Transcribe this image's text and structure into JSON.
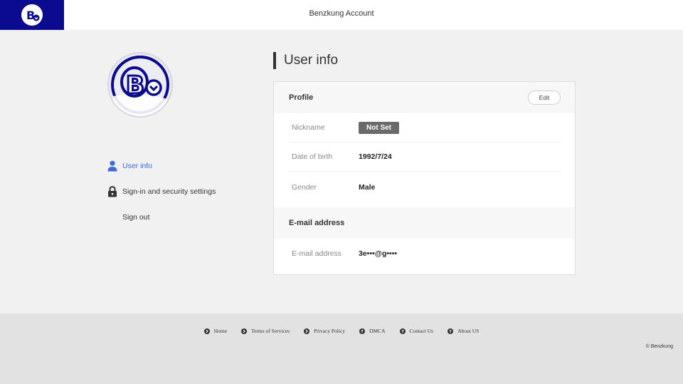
{
  "header": {
    "title": "Benzkung Account",
    "logo_icon": "benzkung-logo",
    "brand_color": "#0b0b8f"
  },
  "sidebar": {
    "items": [
      {
        "label": "User info",
        "icon": "user-icon",
        "active": true
      },
      {
        "label": "Sign-in and security settings",
        "icon": "lock-icon",
        "active": false
      },
      {
        "label": "Sign out",
        "icon": "",
        "active": false
      }
    ],
    "active_color": "#3f6bd9"
  },
  "main": {
    "title": "User info",
    "profile": {
      "heading": "Profile",
      "edit_label": "Edit",
      "rows": [
        {
          "label": "Nickname",
          "value": "Not Set"
        },
        {
          "label": "Date of birth",
          "value": "1992/7/24"
        },
        {
          "label": "Gender",
          "value": "Male"
        }
      ]
    },
    "email": {
      "heading": "E-mail address",
      "rows": [
        {
          "label": "E-mail address",
          "value": "3e•••@g••••"
        }
      ]
    }
  },
  "footer": {
    "links": [
      "Home",
      "Terms of Services",
      "Privacy Policy",
      "DMCA",
      "Contact Us",
      "About US"
    ],
    "copyright": "© Benzkung"
  }
}
